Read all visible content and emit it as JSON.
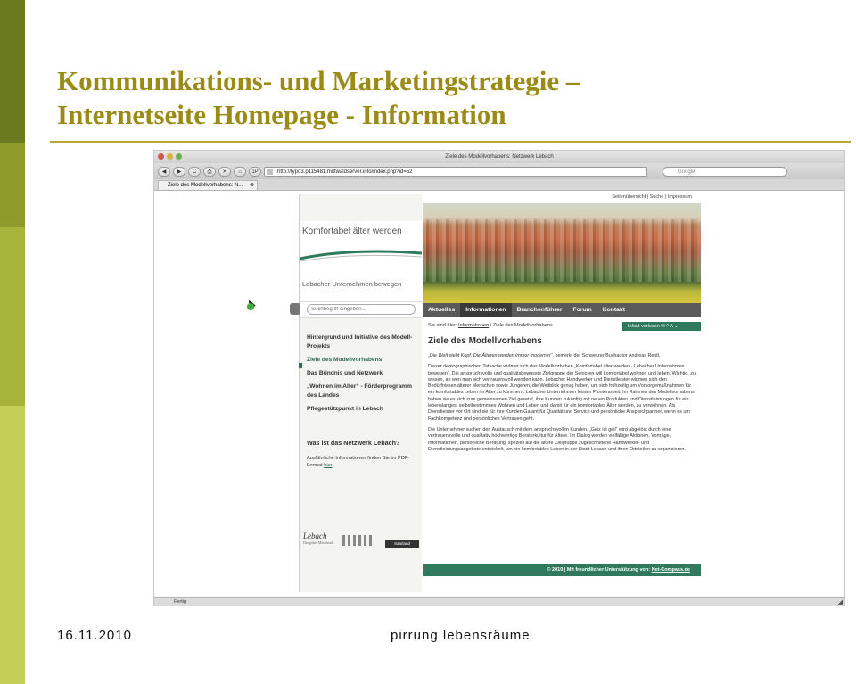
{
  "slide": {
    "title_line1": "Kommunikations- und Marketingstrategie –",
    "title_line2": "Internetseite Homepage - Information",
    "date": "16.11.2010",
    "organization": "pirrung lebensräume"
  },
  "browser": {
    "window_title": "Ziele des Modellvorhabens: Netzwerk Lebach",
    "url": "http://typo3.p115481.mittwaldserver.info/index.php?id=52",
    "search_placeholder": "Google",
    "tab_label": "Ziele des Modellvorhabens: N...",
    "tab_close": "⊗",
    "status": "Fertig",
    "buttons": {
      "back": "◀",
      "forward": "▶",
      "reload": "C",
      "print": "⎙",
      "stop": "✕",
      "home": "⌂",
      "bookmarks": "1P"
    }
  },
  "website": {
    "logo_title": "Komfortabel älter werden",
    "tagline": "Lebacher Unternehmen bewegen",
    "utility_links": "Seitenübersicht | Suche | Impressum",
    "search_placeholder": "Suchbegriff eingeben...",
    "nav": [
      "Aktuelles",
      "Informationen",
      "Branchenführer",
      "Forum",
      "Kontakt"
    ],
    "breadcrumb_prefix": "Sie sind hier:",
    "breadcrumb_link": "Informationen",
    "breadcrumb_current": "/ Ziele des Modellvorhabens",
    "read_aloud": "Inhalt vorlesen  ✉  ^  A  ⌄",
    "page_heading": "Ziele des Modellvorhabens",
    "sidebar": [
      "Hintergrund und Initiative des Modell-Projekts",
      "Ziele des Modellvorhabens",
      "Das Bündnis und Netzwerk",
      "„Wohnen im Alter“ - Förderprogramm des Landes",
      "Pflegestützpunkt in Lebach"
    ],
    "network_heading": "Was ist das Netzwerk Lebach?",
    "network_text": "Ausführliche Informationen finden Sie im PDF-Format",
    "network_link": "hier",
    "logo_lebach": "Lebach",
    "logo_lebach_sub": "Die grüne Mittelstadt",
    "logo_saarland": "Saarland",
    "content": {
      "quote": "„Die Welt steht Kopf. Die Älteren werden immer moderner“",
      "quote_suffix": ", bemerkt der Schweizer Buchautor Andreas Reidl.",
      "p2": "Dieser demographischen Tatsache widmet sich das Modellvorhaben „Komfortabel älter werden - Lebacher Unternehmen bewegen“. Die anspruchsvolle und qualitätsbewusste Zielgruppe der Senioren will komfortabel wohnen und leben. Wichtig, zu wissen, an wen man sich vertrauensvoll wenden kann. Lebacher Handwerker und Dienstleister widmen sich den Bedürfnissen älterer Menschen sowie Jüngeren, die Weitblick genug haben, um sich frühzeitig um Vorsorgemaßnahmen für ein komfortables Leben im Alter zu kümmern. Lebacher Unternehmen leisten Pionierarbeit. Im Rahmen des Modellvorhabens haben sie es sich zum gemeinsamen Ziel gesetzt, ihre Kunden zukünftig mit neuen Produkten und Dienstleistungen für ein lebenslanges, selbstbestimmtes Wohnen und Leben und damit für ein komfortables Älter werden, zu verwöhnen. Als Dienstleister vor Ort sind sie für ihre Kunden Garant für Qualität und Service und persönliche Ansprechpartner, wenn es um Fachkompetenz und persönliches Vertrauen geht.",
      "p3": "Die Unternehmer suchen den Austausch mit dem anspruchsvollen Kunden. „Geiz ist geil“ wird abgelöst durch eine vertrauensvolle und qualitativ hochwertige Beraterkultur für Ältere. Im Dialog werden vielfältige Aktionen, Vorträge, Informationen, persönliche Beratung, speziell auf die ältere Zielgruppe zugeschnittene Handwerker- und Dienstleistungsangebote entwickelt, um ein komfortables Leben in der Stadt Lebach und ihren Ortsteilen zu organisieren."
    },
    "footer_text": "© 2010 | Mit freundlicher Unterstützung von:",
    "footer_link": "Net-Compass.de"
  },
  "colors": {
    "title": "#9a8a16",
    "accent_green": "#2f7a5c",
    "nav_gray": "#5a5a5a"
  }
}
